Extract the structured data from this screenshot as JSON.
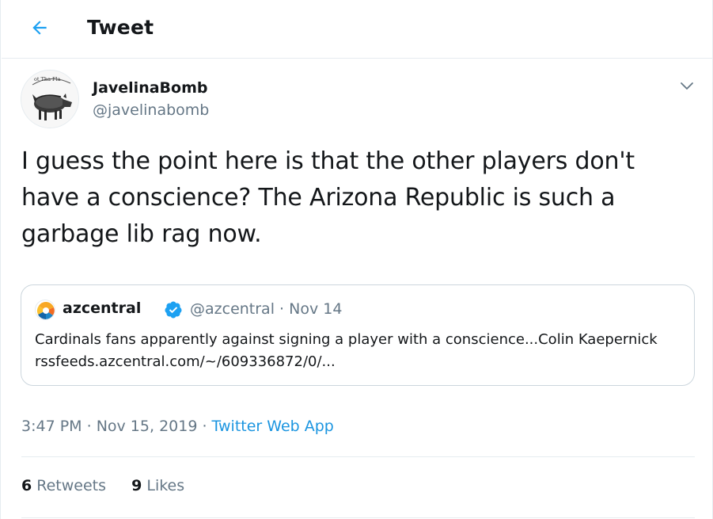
{
  "header": {
    "title": "Tweet",
    "back_icon": "arrow-left-icon"
  },
  "author": {
    "name": "JavelinaBomb",
    "handle": "@javelinabomb",
    "avatar_text": "ot Tha Fla"
  },
  "tweet": {
    "text": "I guess the point here is that the other players don't have a conscience? The Arizona Republic is such a garbage lib rag now."
  },
  "quoted_tweet": {
    "name": "azcentral",
    "verified": true,
    "handle": "@azcentral",
    "separator": " · ",
    "date": "Nov 14",
    "text": "Cardinals fans apparently against signing a player with a conscience...Colin Kaepernick rssfeeds.azcentral.com/~/609336872/0/..."
  },
  "meta": {
    "time": "3:47 PM",
    "separator": " · ",
    "date": "Nov 15, 2019",
    "separator2": " · ",
    "source": "Twitter Web App"
  },
  "stats": {
    "retweets_count": "6",
    "retweets_label": " Retweets",
    "likes_count": "9",
    "likes_label": " Likes"
  },
  "colors": {
    "accent": "#1b95e0",
    "text_primary": "#14171a",
    "text_secondary": "#657786",
    "border": "#e6ecf0",
    "verified": "#1da1f2"
  }
}
